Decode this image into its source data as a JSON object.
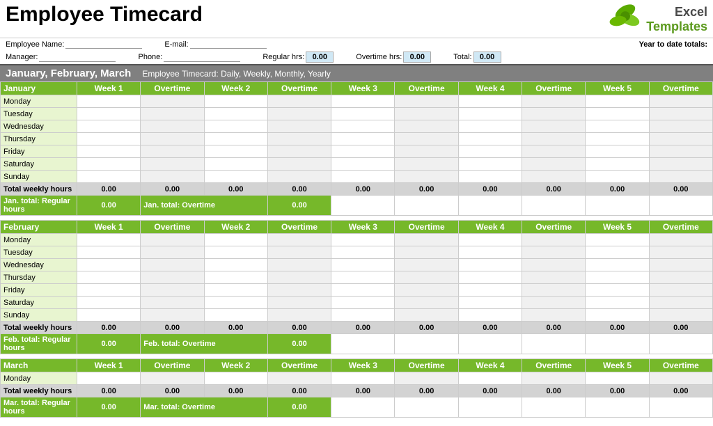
{
  "header": {
    "title": "Employee Timecard",
    "logo_excel": "Excel",
    "logo_templates": "Templates"
  },
  "form": {
    "employee_name_label": "Employee Name:",
    "email_label": "E-mail:",
    "manager_label": "Manager:",
    "phone_label": "Phone:",
    "ytd_label": "Year to date totals:",
    "regular_hrs_label": "Regular hrs:",
    "overtime_hrs_label": "Overtime hrs:",
    "total_label": "Total:",
    "regular_hrs_value": "0.00",
    "overtime_hrs_value": "0.00",
    "total_value": "0.00"
  },
  "quarter": {
    "months": "January, February, March",
    "subtitle": "Employee Timecard: Daily, Weekly, Monthly, Yearly"
  },
  "months": [
    {
      "name": "January",
      "days": [
        "Monday",
        "Tuesday",
        "Wednesday",
        "Thursday",
        "Friday",
        "Saturday",
        "Sunday"
      ],
      "columns": [
        "Week 1",
        "Overtime",
        "Week 2",
        "Overtime",
        "Week 3",
        "Overtime",
        "Week 4",
        "Overtime",
        "Week 5",
        "Overtime"
      ],
      "total_label": "Total weekly hours",
      "total_values": [
        "0.00",
        "0.00",
        "0.00",
        "0.00",
        "0.00",
        "0.00",
        "0.00",
        "0.00",
        "0.00",
        "0.00"
      ],
      "reg_total_label": "Jan. total: Regular hours",
      "reg_total_value": "0.00",
      "ot_total_label": "Jan. total: Overtime",
      "ot_total_value": "0.00"
    },
    {
      "name": "February",
      "days": [
        "Monday",
        "Tuesday",
        "Wednesday",
        "Thursday",
        "Friday",
        "Saturday",
        "Sunday"
      ],
      "columns": [
        "Week 1",
        "Overtime",
        "Week 2",
        "Overtime",
        "Week 3",
        "Overtime",
        "Week 4",
        "Overtime",
        "Week 5",
        "Overtime"
      ],
      "total_label": "Total weekly hours",
      "total_values": [
        "0.00",
        "0.00",
        "0.00",
        "0.00",
        "0.00",
        "0.00",
        "0.00",
        "0.00",
        "0.00",
        "0.00"
      ],
      "reg_total_label": "Feb. total: Regular hours",
      "reg_total_value": "0.00",
      "ot_total_label": "Feb. total: Overtime",
      "ot_total_value": "0.00"
    },
    {
      "name": "March",
      "days": [
        "Monday"
      ],
      "columns": [
        "Week 1",
        "Overtime",
        "Week 2",
        "Overtime",
        "Week 3",
        "Overtime",
        "Week 4",
        "Overtime",
        "Week 5",
        "Overtime"
      ],
      "total_label": "Total weekly hours",
      "total_values": [
        "0.00",
        "0.00",
        "0.00",
        "0.00",
        "0.00",
        "0.00",
        "0.00",
        "0.00",
        "0.00",
        "0.00"
      ],
      "reg_total_label": "Mar. total: Regular hours",
      "reg_total_value": "0.00",
      "ot_total_label": "Mar. total: Overtime",
      "ot_total_value": "0.00"
    }
  ]
}
